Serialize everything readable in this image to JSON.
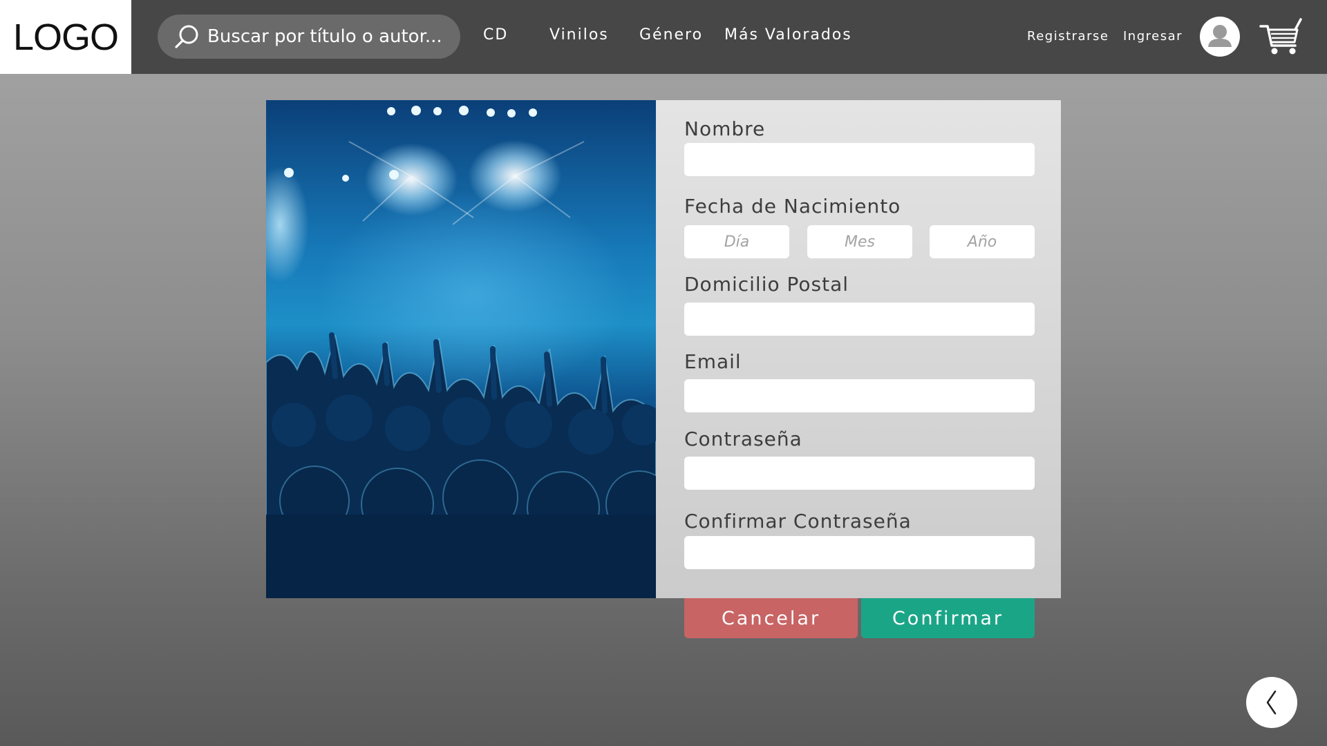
{
  "header": {
    "logo": "LOGO",
    "search_placeholder": "Buscar por título o autor...",
    "nav": [
      "CD",
      "Vinilos",
      "Género",
      "Más Valorados"
    ],
    "register": "Registrarse",
    "login": "Ingresar"
  },
  "form": {
    "name_label": "Nombre",
    "birthdate_label": "Fecha de Nacimiento",
    "day_placeholder": "Día",
    "month_placeholder": "Mes",
    "year_placeholder": "Año",
    "address_label": "Domicilio Postal",
    "email_label": "Email",
    "password_label": "Contraseña",
    "confirm_password_label": "Confirmar Contraseña",
    "cancel_label": "Cancelar",
    "confirm_label": "Confirmar"
  },
  "icons": {
    "search": "search-icon",
    "user": "user-icon",
    "cart": "cart-icon",
    "back": "chevron-left-icon"
  },
  "colors": {
    "topbar": "#474747",
    "cancel": "#c86464",
    "confirm": "#1ba587"
  }
}
